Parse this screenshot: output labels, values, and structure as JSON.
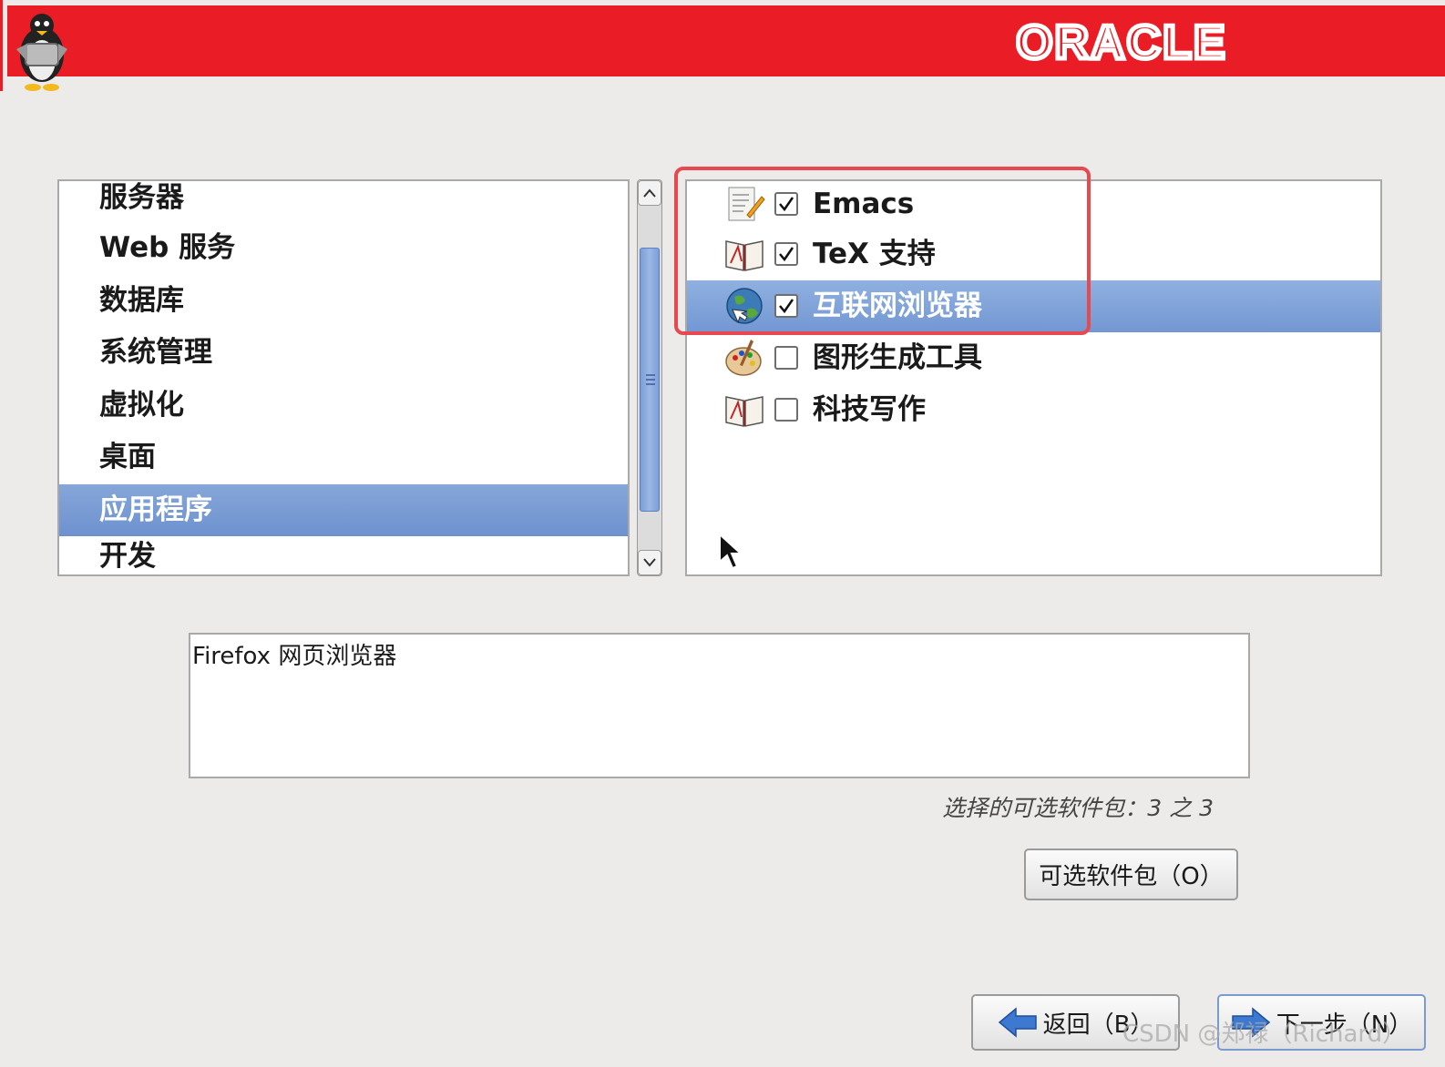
{
  "header": {
    "logo_text": "ORACLE"
  },
  "categories": {
    "items": [
      {
        "label": "服务器"
      },
      {
        "label": "Web 服务"
      },
      {
        "label": "数据库"
      },
      {
        "label": "系统管理"
      },
      {
        "label": "虚拟化"
      },
      {
        "label": "桌面"
      },
      {
        "label": "应用程序"
      },
      {
        "label": "开发"
      }
    ],
    "selected": "应用程序"
  },
  "packages": {
    "items": [
      {
        "label": "Emacs",
        "checked": true,
        "icon": "text-editor-icon"
      },
      {
        "label": "TeX 支持",
        "checked": true,
        "icon": "book-icon"
      },
      {
        "label": "互联网浏览器",
        "checked": true,
        "icon": "globe-icon"
      },
      {
        "label": "图形生成工具",
        "checked": false,
        "icon": "palette-icon"
      },
      {
        "label": "科技写作",
        "checked": false,
        "icon": "book-icon"
      }
    ],
    "selected": "互联网浏览器"
  },
  "description": {
    "text": "Firefox 网页浏览器"
  },
  "status": {
    "selected_count": "选择的可选软件包：3 之 3"
  },
  "buttons": {
    "optional_packages": "可选软件包（O）",
    "back": "返回（B）",
    "next": "下一步（N）"
  },
  "watermark": "CSDN @郑禄（Richard）",
  "colors": {
    "header_red": "#ea1c25",
    "selection_blue": "#7397d3",
    "highlight_border": "#e8484f"
  }
}
